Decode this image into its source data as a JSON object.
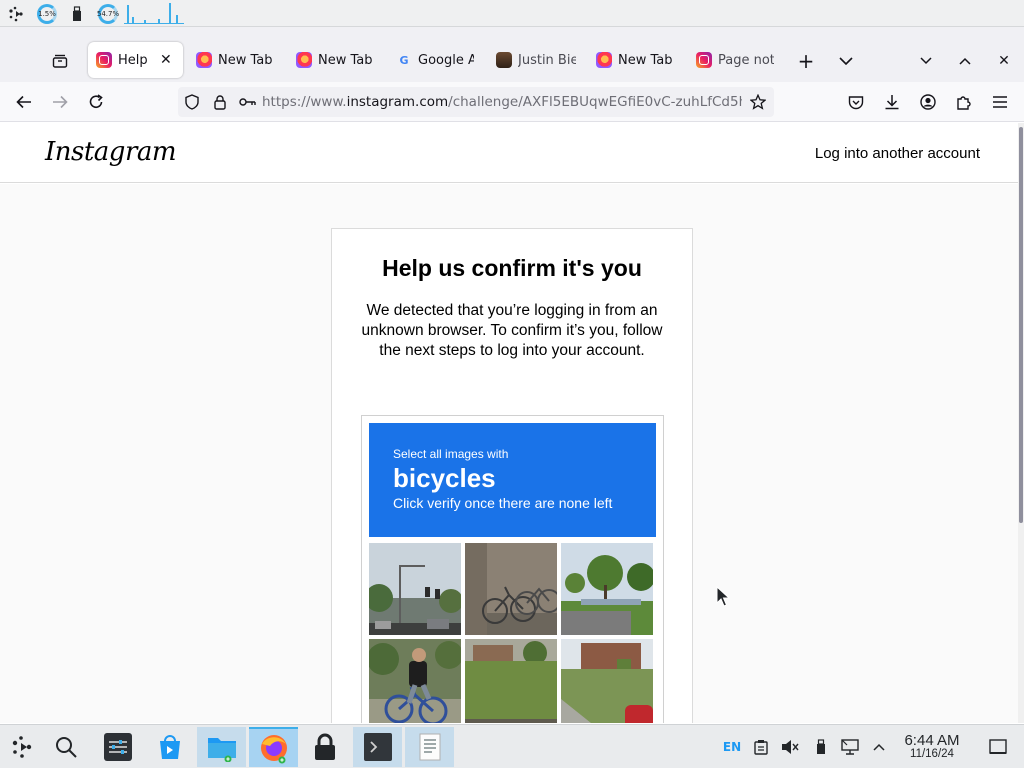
{
  "system_panel": {
    "cpu_label": "1.5%",
    "mem_label": "54.7%"
  },
  "browser": {
    "tabs": [
      {
        "label": "Help u",
        "favicon": "instagram-icon",
        "active": true
      },
      {
        "label": "New Tab",
        "favicon": "firefox-icon",
        "active": false
      },
      {
        "label": "New Tab",
        "favicon": "firefox-icon",
        "active": false
      },
      {
        "label": "Google A",
        "favicon": "google-icon",
        "active": false
      },
      {
        "label": "Justin Bie",
        "favicon": "person-photo-icon",
        "active": false
      },
      {
        "label": "New Tab",
        "favicon": "firefox-icon",
        "active": false
      },
      {
        "label": "Page not",
        "favicon": "instagram-icon",
        "active": false
      }
    ],
    "url": {
      "prefix": "https://www.",
      "host": "instagram.com",
      "path": "/challenge/AXFl5EBUqwEGfiE0vC-zuhLfCd5h"
    }
  },
  "instagram": {
    "logo": "Instagram",
    "login_other": "Log into another account",
    "card_title": "Help us confirm it's you",
    "card_description": "We detected that you’re logging in from an unknown browser. To confirm it’s you, follow the next steps to log into your account.",
    "captcha": {
      "prefix": "Select all images with",
      "object": "bicycles",
      "instruction": "Click verify once there are none left",
      "header_color": "#1a73e8"
    }
  },
  "taskbar": {
    "language": "EN",
    "time": "6:44 AM",
    "date": "11/16/24"
  }
}
